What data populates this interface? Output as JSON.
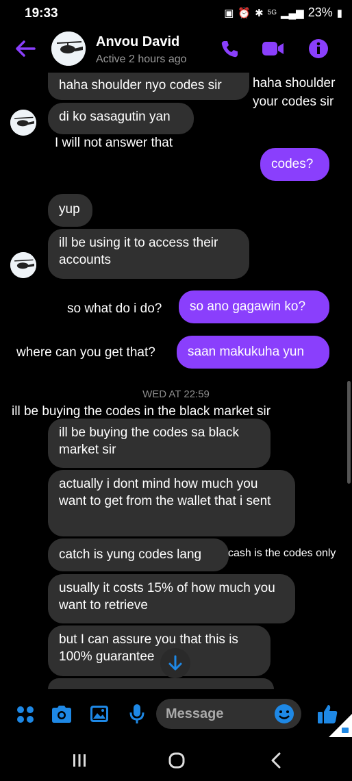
{
  "status_bar": {
    "time": "19:33",
    "battery": "23%",
    "network": "5G"
  },
  "header": {
    "name": "Anvou David",
    "status": "Active 2 hours ago"
  },
  "messages": {
    "m1": "haha shoulder nyo codes sir",
    "m2": "di ko sasagutin yan",
    "m3": "codes?",
    "m4": "yup",
    "m5": "ill be using it to access their accounts",
    "m6": "so ano gagawin ko?",
    "m7": "saan makukuha yun",
    "m8": "ill be buying the codes sa black market sir",
    "m9": "actually i dont mind how much you want to get from the wallet that i sent",
    "m10": "catch is yung codes lang",
    "m11": "usually it costs 15% of how much you want to retrieve",
    "m12": "but I can assure you that this is 100% guarantee"
  },
  "translations": {
    "t1": "haha shoulder your codes sir",
    "t2": "I will not answer that",
    "t3": "so what do i do?",
    "t4": "where can you get that?",
    "t5": "ill be buying the codes in the black market sir",
    "t6": "cash is the codes only"
  },
  "date_separator": "WED AT 22:59",
  "composer": {
    "placeholder": "Message"
  },
  "colors": {
    "accent": "#8a3ffc",
    "bubble_in": "#303030",
    "composer_icons": "#1e88e5"
  },
  "icons": [
    "back-arrow-icon",
    "phone-icon",
    "video-icon",
    "info-icon",
    "apps-icon",
    "camera-icon",
    "gallery-icon",
    "mic-icon",
    "emoji-icon",
    "like-icon",
    "scroll-down-icon",
    "recents-icon",
    "home-icon",
    "back-nav-icon"
  ]
}
